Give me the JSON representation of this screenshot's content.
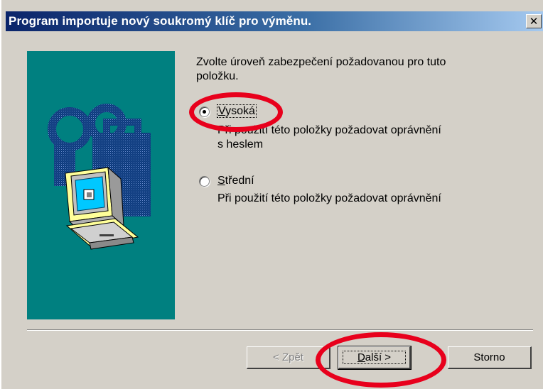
{
  "window": {
    "title": "Program importuje nový soukromý klíč pro výměnu.",
    "close_label": "✕"
  },
  "content": {
    "instruction_line1": "Zvolte úroveň zabezpečení požadovanou pro tuto",
    "instruction_line2": "položku."
  },
  "options": [
    {
      "label_first": "V",
      "label_rest": "ysoká",
      "description_line1": "Při použití této položky požadovat oprávnění",
      "description_line2": "s heslem",
      "selected": true
    },
    {
      "label_first": "S",
      "label_rest": "třední",
      "description_line1": "Při použití této položky požadovat oprávnění",
      "description_line2": "",
      "selected": false
    }
  ],
  "buttons": {
    "back_label": "< Zpět",
    "next_underlined": "D",
    "next_rest": "alší >",
    "cancel_label": "Storno"
  },
  "colors": {
    "title_gradient_start": "#0a246a",
    "title_gradient_end": "#a6caf0",
    "dialog_face": "#d4d0c8",
    "wizard_panel": "#008080",
    "annotation_red": "#e8001c"
  }
}
